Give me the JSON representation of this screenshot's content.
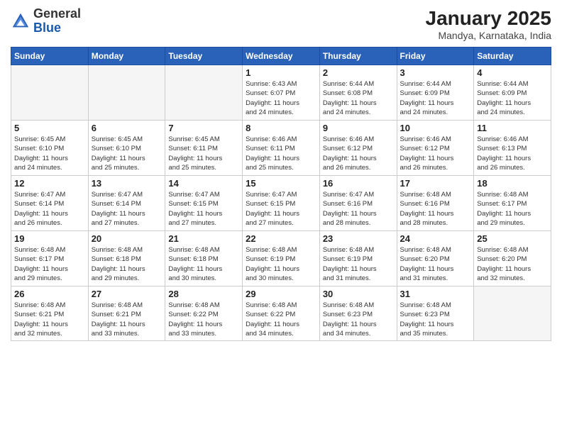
{
  "logo": {
    "general": "General",
    "blue": "Blue"
  },
  "title": {
    "main": "January 2025",
    "sub": "Mandya, Karnataka, India"
  },
  "days_of_week": [
    "Sunday",
    "Monday",
    "Tuesday",
    "Wednesday",
    "Thursday",
    "Friday",
    "Saturday"
  ],
  "weeks": [
    [
      {
        "day": "",
        "info": ""
      },
      {
        "day": "",
        "info": ""
      },
      {
        "day": "",
        "info": ""
      },
      {
        "day": "1",
        "info": "Sunrise: 6:43 AM\nSunset: 6:07 PM\nDaylight: 11 hours\nand 24 minutes."
      },
      {
        "day": "2",
        "info": "Sunrise: 6:44 AM\nSunset: 6:08 PM\nDaylight: 11 hours\nand 24 minutes."
      },
      {
        "day": "3",
        "info": "Sunrise: 6:44 AM\nSunset: 6:09 PM\nDaylight: 11 hours\nand 24 minutes."
      },
      {
        "day": "4",
        "info": "Sunrise: 6:44 AM\nSunset: 6:09 PM\nDaylight: 11 hours\nand 24 minutes."
      }
    ],
    [
      {
        "day": "5",
        "info": "Sunrise: 6:45 AM\nSunset: 6:10 PM\nDaylight: 11 hours\nand 24 minutes."
      },
      {
        "day": "6",
        "info": "Sunrise: 6:45 AM\nSunset: 6:10 PM\nDaylight: 11 hours\nand 25 minutes."
      },
      {
        "day": "7",
        "info": "Sunrise: 6:45 AM\nSunset: 6:11 PM\nDaylight: 11 hours\nand 25 minutes."
      },
      {
        "day": "8",
        "info": "Sunrise: 6:46 AM\nSunset: 6:11 PM\nDaylight: 11 hours\nand 25 minutes."
      },
      {
        "day": "9",
        "info": "Sunrise: 6:46 AM\nSunset: 6:12 PM\nDaylight: 11 hours\nand 26 minutes."
      },
      {
        "day": "10",
        "info": "Sunrise: 6:46 AM\nSunset: 6:12 PM\nDaylight: 11 hours\nand 26 minutes."
      },
      {
        "day": "11",
        "info": "Sunrise: 6:46 AM\nSunset: 6:13 PM\nDaylight: 11 hours\nand 26 minutes."
      }
    ],
    [
      {
        "day": "12",
        "info": "Sunrise: 6:47 AM\nSunset: 6:14 PM\nDaylight: 11 hours\nand 26 minutes."
      },
      {
        "day": "13",
        "info": "Sunrise: 6:47 AM\nSunset: 6:14 PM\nDaylight: 11 hours\nand 27 minutes."
      },
      {
        "day": "14",
        "info": "Sunrise: 6:47 AM\nSunset: 6:15 PM\nDaylight: 11 hours\nand 27 minutes."
      },
      {
        "day": "15",
        "info": "Sunrise: 6:47 AM\nSunset: 6:15 PM\nDaylight: 11 hours\nand 27 minutes."
      },
      {
        "day": "16",
        "info": "Sunrise: 6:47 AM\nSunset: 6:16 PM\nDaylight: 11 hours\nand 28 minutes."
      },
      {
        "day": "17",
        "info": "Sunrise: 6:48 AM\nSunset: 6:16 PM\nDaylight: 11 hours\nand 28 minutes."
      },
      {
        "day": "18",
        "info": "Sunrise: 6:48 AM\nSunset: 6:17 PM\nDaylight: 11 hours\nand 29 minutes."
      }
    ],
    [
      {
        "day": "19",
        "info": "Sunrise: 6:48 AM\nSunset: 6:17 PM\nDaylight: 11 hours\nand 29 minutes."
      },
      {
        "day": "20",
        "info": "Sunrise: 6:48 AM\nSunset: 6:18 PM\nDaylight: 11 hours\nand 29 minutes."
      },
      {
        "day": "21",
        "info": "Sunrise: 6:48 AM\nSunset: 6:18 PM\nDaylight: 11 hours\nand 30 minutes."
      },
      {
        "day": "22",
        "info": "Sunrise: 6:48 AM\nSunset: 6:19 PM\nDaylight: 11 hours\nand 30 minutes."
      },
      {
        "day": "23",
        "info": "Sunrise: 6:48 AM\nSunset: 6:19 PM\nDaylight: 11 hours\nand 31 minutes."
      },
      {
        "day": "24",
        "info": "Sunrise: 6:48 AM\nSunset: 6:20 PM\nDaylight: 11 hours\nand 31 minutes."
      },
      {
        "day": "25",
        "info": "Sunrise: 6:48 AM\nSunset: 6:20 PM\nDaylight: 11 hours\nand 32 minutes."
      }
    ],
    [
      {
        "day": "26",
        "info": "Sunrise: 6:48 AM\nSunset: 6:21 PM\nDaylight: 11 hours\nand 32 minutes."
      },
      {
        "day": "27",
        "info": "Sunrise: 6:48 AM\nSunset: 6:21 PM\nDaylight: 11 hours\nand 33 minutes."
      },
      {
        "day": "28",
        "info": "Sunrise: 6:48 AM\nSunset: 6:22 PM\nDaylight: 11 hours\nand 33 minutes."
      },
      {
        "day": "29",
        "info": "Sunrise: 6:48 AM\nSunset: 6:22 PM\nDaylight: 11 hours\nand 34 minutes."
      },
      {
        "day": "30",
        "info": "Sunrise: 6:48 AM\nSunset: 6:23 PM\nDaylight: 11 hours\nand 34 minutes."
      },
      {
        "day": "31",
        "info": "Sunrise: 6:48 AM\nSunset: 6:23 PM\nDaylight: 11 hours\nand 35 minutes."
      },
      {
        "day": "",
        "info": ""
      }
    ]
  ]
}
